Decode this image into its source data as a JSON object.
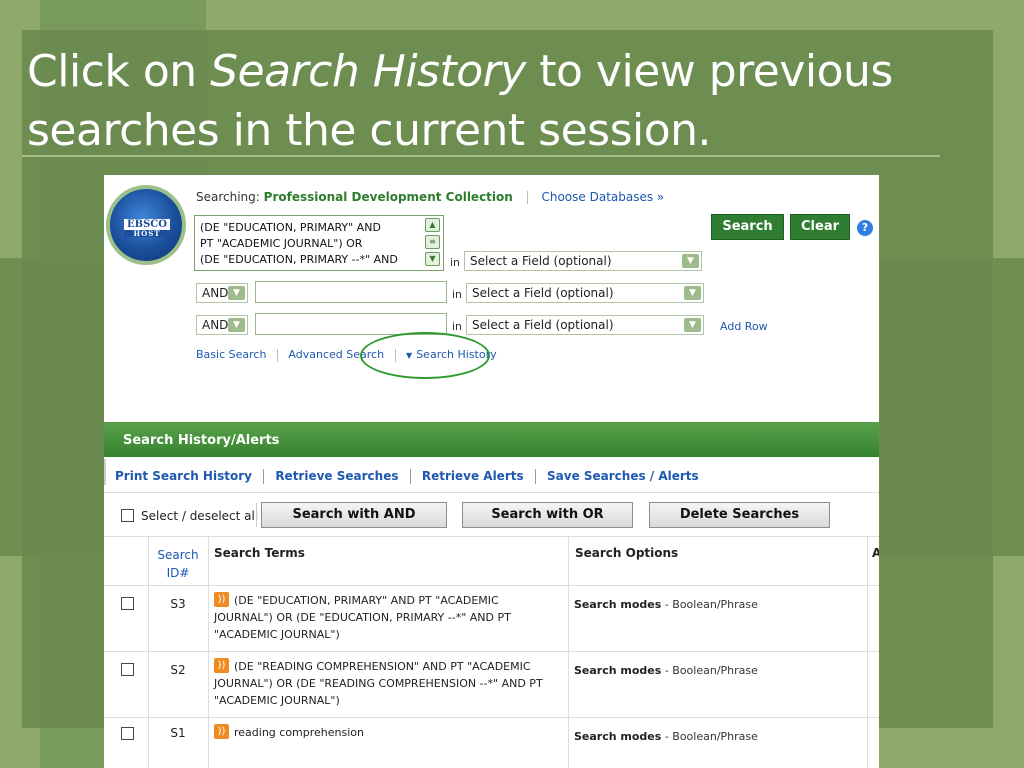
{
  "slide": {
    "title_pre": "Click on ",
    "title_em": "Search History",
    "title_post": " to view previous searches in the current session."
  },
  "logo": {
    "main": "EBSCO",
    "sub": "HOST"
  },
  "searching": {
    "label": "Searching:",
    "database": "Professional Development Collection",
    "choose_link": "Choose Databases »"
  },
  "query": {
    "line1": "(DE \"EDUCATION, PRIMARY\" AND",
    "line2": "PT \"ACADEMIC JOURNAL\") OR",
    "line3": "(DE \"EDUCATION, PRIMARY --*\" AND"
  },
  "rows_form": [
    {
      "bool": "AND",
      "field": "Select a Field (optional)"
    },
    {
      "bool": "AND",
      "field": "Select a Field (optional)"
    }
  ],
  "first_field": "Select a Field (optional)",
  "in_label": "in",
  "buttons": {
    "search": "Search",
    "clear": "Clear",
    "help": "?"
  },
  "add_row": "Add Row",
  "nav": {
    "basic": "Basic Search",
    "advanced": "Advanced Search",
    "history": "Search History"
  },
  "history": {
    "header": "Search History/Alerts",
    "links": [
      "Print Search History",
      "Retrieve Searches",
      "Retrieve Alerts",
      "Save Searches / Alerts"
    ],
    "select_all": "Select / deselect all",
    "btn_and": "Search with AND",
    "btn_or": "Search with OR",
    "btn_delete": "Delete Searches",
    "columns": {
      "id": "Search ID#",
      "terms": "Search Terms",
      "options": "Search Options",
      "actions": "A"
    },
    "rows": [
      {
        "id": "S3",
        "terms": "(DE \"EDUCATION, PRIMARY\" AND PT \"ACADEMIC JOURNAL\") OR (DE \"EDUCATION, PRIMARY --*\" AND PT \"ACADEMIC JOURNAL\")",
        "mode_label": "Search modes",
        "mode_value": " - Boolean/Phrase"
      },
      {
        "id": "S2",
        "terms": "(DE \"READING COMPREHENSION\" AND PT \"ACADEMIC JOURNAL\") OR (DE \"READING COMPREHENSION --*\" AND PT \"ACADEMIC JOURNAL\")",
        "mode_label": "Search modes",
        "mode_value": " - Boolean/Phrase"
      },
      {
        "id": "S1",
        "terms": "reading comprehension",
        "mode_label": "Search modes",
        "mode_value": " - Boolean/Phrase"
      }
    ]
  },
  "colors": {
    "accent_green": "#2f7d32",
    "link_blue": "#1e58b0",
    "rss_orange": "#f08a24"
  }
}
